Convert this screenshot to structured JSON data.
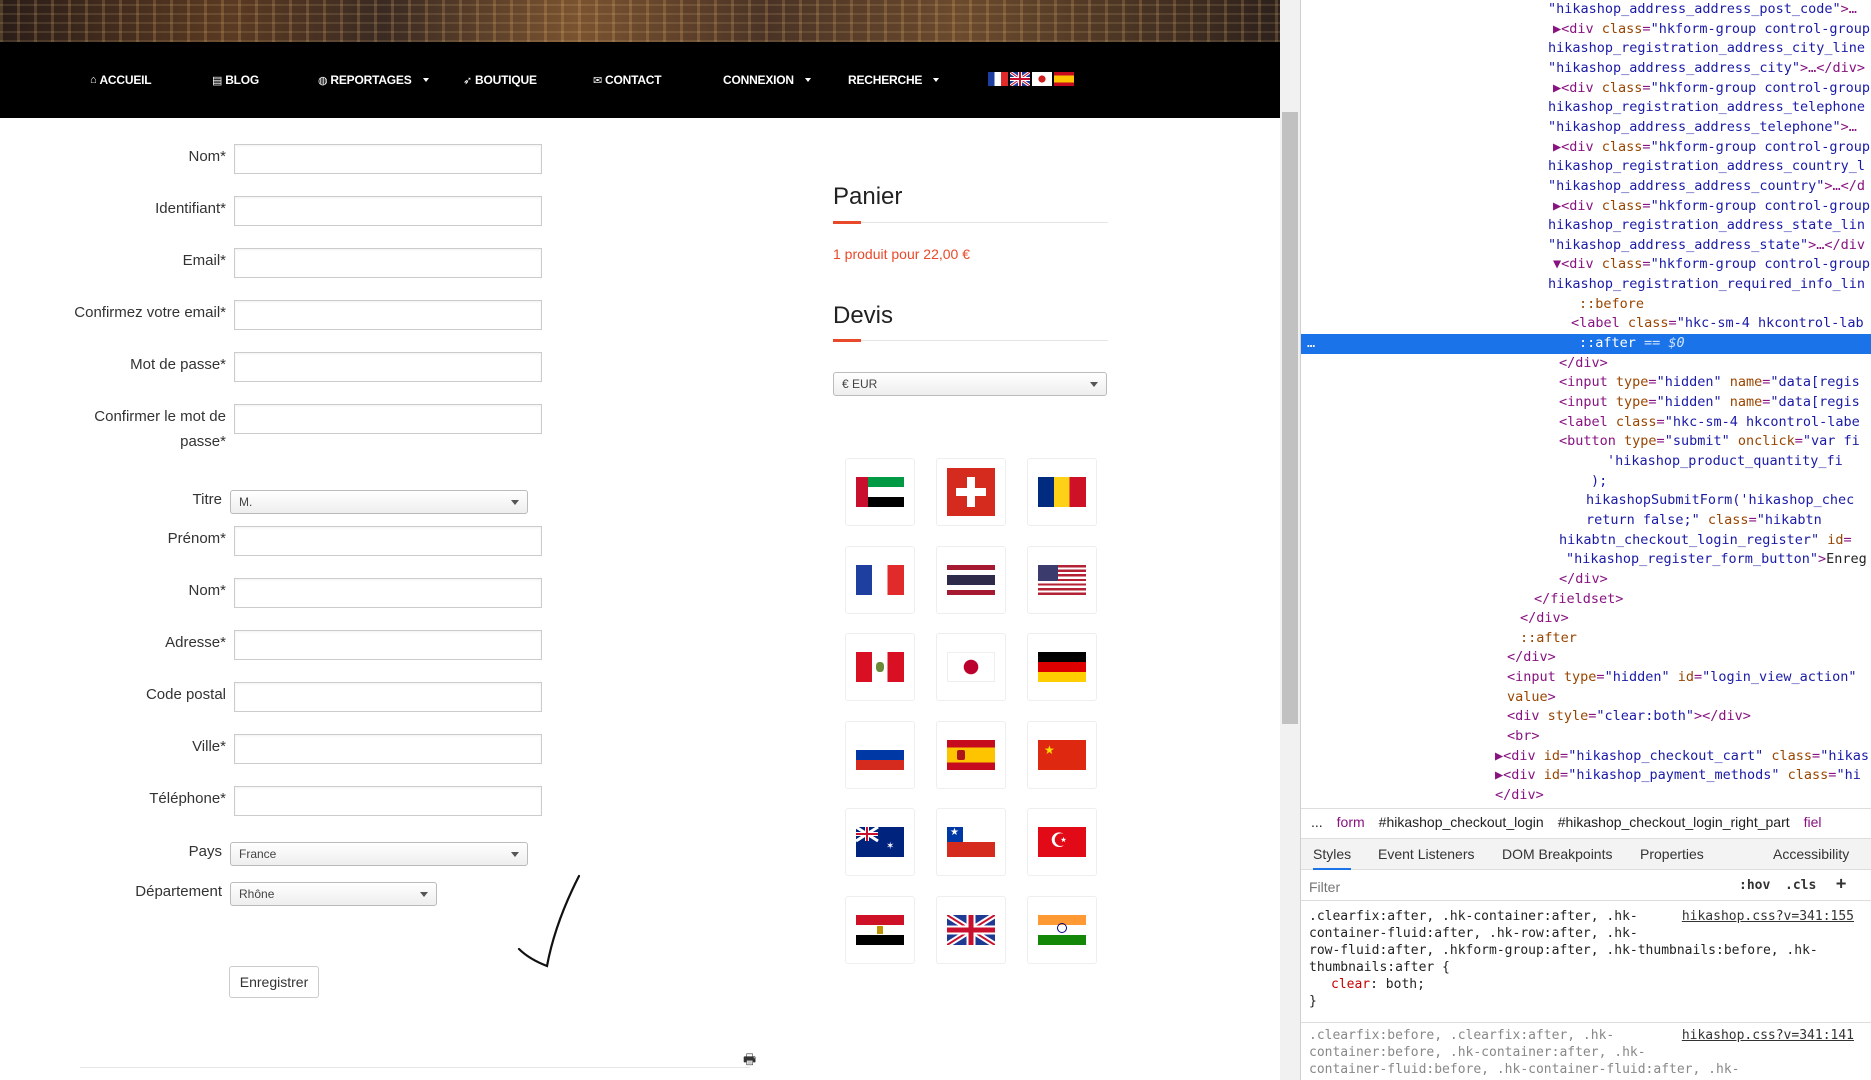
{
  "nav": {
    "items": [
      {
        "label": "ACCUEIL",
        "icon": "home-icon",
        "glyph": "⌂",
        "dropdown": false
      },
      {
        "label": "BLOG",
        "icon": "newspaper-icon",
        "glyph": "▤",
        "dropdown": false
      },
      {
        "label": "REPORTAGES",
        "icon": "globe-icon",
        "glyph": "◍",
        "dropdown": true
      },
      {
        "label": "BOUTIQUE",
        "icon": "rocket-icon",
        "glyph": "➶",
        "dropdown": false
      },
      {
        "label": "CONTACT",
        "icon": "envelope-icon",
        "glyph": "✉",
        "dropdown": false
      },
      {
        "label": "CONNEXION",
        "icon": "",
        "glyph": "",
        "dropdown": true
      },
      {
        "label": "RECHERCHE",
        "icon": "",
        "glyph": "",
        "dropdown": true
      }
    ],
    "languages": [
      "french-flag",
      "english-flag",
      "japanese-flag",
      "spanish-flag"
    ]
  },
  "form": {
    "fields": [
      {
        "label": "Nom*",
        "type": "text"
      },
      {
        "label": "Identifiant*",
        "type": "text"
      },
      {
        "label": "Email*",
        "type": "text"
      },
      {
        "label": "Confirmez votre email*",
        "type": "text"
      },
      {
        "label": "Mot de passe*",
        "type": "text"
      },
      {
        "label": "Confirmer le mot de",
        "label2": "passe*",
        "type": "text"
      },
      {
        "label": "Titre",
        "type": "select",
        "value": "M."
      },
      {
        "label": "Prénom*",
        "type": "text"
      },
      {
        "label": "Nom*",
        "type": "text"
      },
      {
        "label": "Adresse*",
        "type": "text"
      },
      {
        "label": "Code postal",
        "type": "text"
      },
      {
        "label": "Ville*",
        "type": "text"
      },
      {
        "label": "Téléphone*",
        "type": "text"
      },
      {
        "label": "Pays",
        "type": "select",
        "value": "France"
      },
      {
        "label": "Département",
        "type": "select",
        "value": "Rhône"
      }
    ],
    "submit_label": "Enregistrer"
  },
  "cart": {
    "title": "Panier",
    "summary": "1 produit pour 22,00 €"
  },
  "quote": {
    "title": "Devis",
    "currency": "€ EUR",
    "flags": [
      "uae",
      "switzerland",
      "romania",
      "france",
      "thailand",
      "usa",
      "peru",
      "japan",
      "germany",
      "russia",
      "spain",
      "china",
      "australia",
      "chile",
      "turkey",
      "egypt",
      "united-kingdom",
      "india"
    ]
  },
  "devtools": {
    "dom": [
      [
        {
          "c": "av",
          "t": "\"hikashop_address_address_post_code\""
        },
        {
          "c": "p",
          "t": ">…"
        }
      ],
      [
        {
          "c": "p",
          "t": "▶<div "
        },
        {
          "c": "an",
          "t": "class"
        },
        {
          "c": "p",
          "t": "="
        },
        {
          "c": "av",
          "t": "\"hkform-group control-group"
        }
      ],
      [
        {
          "c": "av",
          "t": "hikashop_registration_address_city_line"
        }
      ],
      [
        {
          "c": "av",
          "t": "\"hikashop_address_address_city\""
        },
        {
          "c": "p",
          "t": ">…</div>"
        }
      ],
      [
        {
          "c": "p",
          "t": "▶<div "
        },
        {
          "c": "an",
          "t": "class"
        },
        {
          "c": "p",
          "t": "="
        },
        {
          "c": "av",
          "t": "\"hkform-group control-group"
        }
      ],
      [
        {
          "c": "av",
          "t": "hikashop_registration_address_telephone"
        }
      ],
      [
        {
          "c": "av",
          "t": "\"hikashop_address_address_telephone\""
        },
        {
          "c": "p",
          "t": ">…"
        }
      ],
      [
        {
          "c": "p",
          "t": "▶<div "
        },
        {
          "c": "an",
          "t": "class"
        },
        {
          "c": "p",
          "t": "="
        },
        {
          "c": "av",
          "t": "\"hkform-group control-group"
        }
      ],
      [
        {
          "c": "av",
          "t": "hikashop_registration_address_country_l"
        }
      ],
      [
        {
          "c": "av",
          "t": "\"hikashop_address_address_country\""
        },
        {
          "c": "p",
          "t": ">…</d"
        }
      ],
      [
        {
          "c": "p",
          "t": "▶<div "
        },
        {
          "c": "an",
          "t": "class"
        },
        {
          "c": "p",
          "t": "="
        },
        {
          "c": "av",
          "t": "\"hkform-group control-group"
        }
      ],
      [
        {
          "c": "av",
          "t": "hikashop_registration_address_state_lin"
        }
      ],
      [
        {
          "c": "av",
          "t": "\"hikashop_address_address_state\""
        },
        {
          "c": "p",
          "t": ">…</div"
        }
      ],
      [
        {
          "c": "p",
          "t": "▼<div "
        },
        {
          "c": "an",
          "t": "class"
        },
        {
          "c": "p",
          "t": "="
        },
        {
          "c": "av",
          "t": "\"hkform-group control-group"
        }
      ],
      [
        {
          "c": "av",
          "t": "hikashop_registration_required_info_lin"
        }
      ],
      [
        {
          "c": "ps",
          "t": "::before"
        }
      ],
      [
        {
          "c": "p",
          "t": "<label "
        },
        {
          "c": "an",
          "t": "class"
        },
        {
          "c": "p",
          "t": "="
        },
        {
          "c": "av",
          "t": "\"hkc-sm-4 hkcontrol-lab"
        }
      ],
      [
        {
          "c": "p",
          "t": "::after"
        },
        {
          "c": "p",
          "t": " == $0"
        }
      ],
      [
        {
          "c": "p",
          "t": "</div>"
        }
      ],
      [
        {
          "c": "p",
          "t": "<input "
        },
        {
          "c": "an",
          "t": "type"
        },
        {
          "c": "p",
          "t": "="
        },
        {
          "c": "av",
          "t": "\"hidden\""
        },
        {
          "c": "an",
          "t": " name"
        },
        {
          "c": "p",
          "t": "="
        },
        {
          "c": "av",
          "t": "\"data[regis"
        }
      ],
      [
        {
          "c": "p",
          "t": "<input "
        },
        {
          "c": "an",
          "t": "type"
        },
        {
          "c": "p",
          "t": "="
        },
        {
          "c": "av",
          "t": "\"hidden\""
        },
        {
          "c": "an",
          "t": " name"
        },
        {
          "c": "p",
          "t": "="
        },
        {
          "c": "av",
          "t": "\"data[regis"
        }
      ],
      [
        {
          "c": "p",
          "t": "<label "
        },
        {
          "c": "an",
          "t": "class"
        },
        {
          "c": "p",
          "t": "="
        },
        {
          "c": "av",
          "t": "\"hkc-sm-4 hkcontrol-labe"
        }
      ],
      [
        {
          "c": "p",
          "t": "<button "
        },
        {
          "c": "an",
          "t": "type"
        },
        {
          "c": "p",
          "t": "="
        },
        {
          "c": "av",
          "t": "\"submit\""
        },
        {
          "c": "an",
          "t": " onclick"
        },
        {
          "c": "p",
          "t": "="
        },
        {
          "c": "av",
          "t": "\"var fi"
        }
      ],
      [
        {
          "c": "av",
          "t": "'hikashop_product_quantity_fi"
        }
      ],
      [
        {
          "c": "av",
          "t": ");"
        }
      ],
      [
        {
          "c": "av",
          "t": "hikashopSubmitForm('hikashop_chec"
        }
      ],
      [
        {
          "c": "av",
          "t": "return false;\""
        },
        {
          "c": "an",
          "t": " class"
        },
        {
          "c": "p",
          "t": "="
        },
        {
          "c": "av",
          "t": "\"hikabtn"
        }
      ],
      [
        {
          "c": "av",
          "t": "hikabtn_checkout_login_register\""
        },
        {
          "c": "an",
          "t": " id"
        },
        {
          "c": "p",
          "t": "="
        }
      ],
      [
        {
          "c": "av",
          "t": "\"hikashop_register_form_button\""
        },
        {
          "c": "p",
          "t": ">"
        },
        {
          "c": "tx",
          "t": "Enreg"
        }
      ],
      [
        {
          "c": "p",
          "t": "</div>"
        }
      ],
      [
        {
          "c": "p",
          "t": "</fieldset>"
        }
      ],
      [
        {
          "c": "p",
          "t": "</div>"
        }
      ],
      [
        {
          "c": "ps",
          "t": "::after"
        }
      ],
      [
        {
          "c": "p",
          "t": "</div>"
        }
      ],
      [
        {
          "c": "p",
          "t": "<input "
        },
        {
          "c": "an",
          "t": "type"
        },
        {
          "c": "p",
          "t": "="
        },
        {
          "c": "av",
          "t": "\"hidden\""
        },
        {
          "c": "an",
          "t": " id"
        },
        {
          "c": "p",
          "t": "="
        },
        {
          "c": "av",
          "t": "\"login_view_action\""
        }
      ],
      [
        {
          "c": "an",
          "t": "value"
        },
        {
          "c": "p",
          "t": ">"
        }
      ],
      [
        {
          "c": "p",
          "t": "<div "
        },
        {
          "c": "an",
          "t": "style"
        },
        {
          "c": "p",
          "t": "="
        },
        {
          "c": "av",
          "t": "\"clear:both\""
        },
        {
          "c": "p",
          "t": "></div>"
        }
      ],
      [
        {
          "c": "p",
          "t": "<br>"
        }
      ],
      [
        {
          "c": "p",
          "t": "▶<div "
        },
        {
          "c": "an",
          "t": "id"
        },
        {
          "c": "p",
          "t": "="
        },
        {
          "c": "av",
          "t": "\"hikashop_checkout_cart\""
        },
        {
          "c": "an",
          "t": " class"
        },
        {
          "c": "p",
          "t": "="
        },
        {
          "c": "av",
          "t": "\"hikas"
        }
      ],
      [
        {
          "c": "p",
          "t": "▶<div "
        },
        {
          "c": "an",
          "t": "id"
        },
        {
          "c": "p",
          "t": "="
        },
        {
          "c": "av",
          "t": "\"hikashop_payment_methods\""
        },
        {
          "c": "an",
          "t": " class"
        },
        {
          "c": "p",
          "t": "="
        },
        {
          "c": "av",
          "t": "\"hi"
        }
      ],
      [
        {
          "c": "p",
          "t": "</div>"
        }
      ]
    ],
    "breadcrumb": [
      "...",
      "form",
      "#hikashop_checkout_login",
      "#hikashop_checkout_login_right_part",
      "fiel"
    ],
    "tabs": [
      "Styles",
      "Event Listeners",
      "DOM Breakpoints",
      "Properties",
      "Accessibility"
    ],
    "filter_placeholder": "Filter",
    "hov": ":hov",
    "cls": ".cls",
    "plus": "+",
    "rule1": {
      "source": "hikashop.css?v=341:155",
      "selectors": [
        ".clearfix:after, .hk-container:after, .hk-",
        "container-fluid:after, .hk-row:after, .hk-",
        "row-fluid:after, .hkform-group:after, .hk-thumbnails:before, .hk-",
        "thumbnails:after {"
      ],
      "prop": "clear",
      "val": "both;",
      "close": "}"
    },
    "rule2": {
      "source": "hikashop.css?v=341:141",
      "selectors": [
        ".clearfix:before, .clearfix:after, .hk-",
        "container:before, .hk-container:after, .hk-",
        "container-fluid:before, .hk-container-fluid:after, .hk-"
      ]
    }
  }
}
